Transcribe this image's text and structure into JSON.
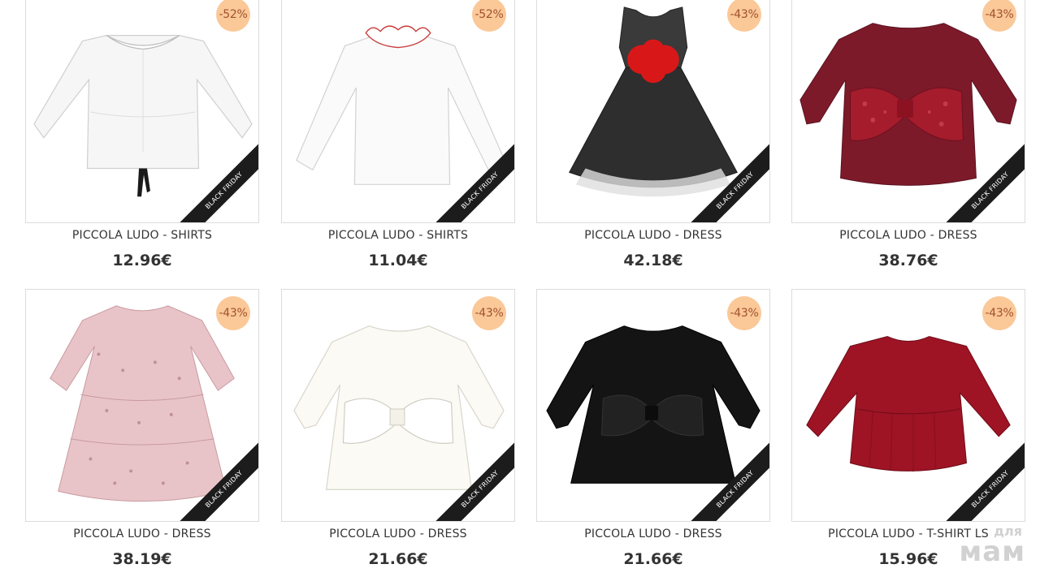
{
  "colors": {
    "badge_bg": "#fbc898",
    "badge_text": "#a0522d",
    "ribbon_bg": "#1c1c1c"
  },
  "products": [
    {
      "title": "PICCOLA LUDO - SHIRTS",
      "price": "12.96€",
      "discount": "-52%",
      "ribbon": "BLACK FRIDAY"
    },
    {
      "title": "PICCOLA LUDO - SHIRTS",
      "price": "11.04€",
      "discount": "-52%",
      "ribbon": "BLACK FRIDAY"
    },
    {
      "title": "PICCOLA LUDO - DRESS",
      "price": "42.18€",
      "discount": "-43%",
      "ribbon": "BLACK FRIDAY"
    },
    {
      "title": "PICCOLA LUDO - DRESS",
      "price": "38.76€",
      "discount": "-43%",
      "ribbon": "BLACK FRIDAY"
    },
    {
      "title": "PICCOLA LUDO - DRESS",
      "price": "38.19€",
      "discount": "-43%",
      "ribbon": "BLACK FRIDAY"
    },
    {
      "title": "PICCOLA LUDO - DRESS",
      "price": "21.66€",
      "discount": "-43%",
      "ribbon": "BLACK FRIDAY"
    },
    {
      "title": "PICCOLA LUDO - DRESS",
      "price": "21.66€",
      "discount": "-43%",
      "ribbon": "BLACK FRIDAY"
    },
    {
      "title": "PICCOLA LUDO - T-SHIRT LS",
      "price": "15.96€",
      "discount": "-43%",
      "ribbon": "BLACK FRIDAY"
    }
  ],
  "watermark": {
    "line1": "для",
    "line2": "мам"
  }
}
